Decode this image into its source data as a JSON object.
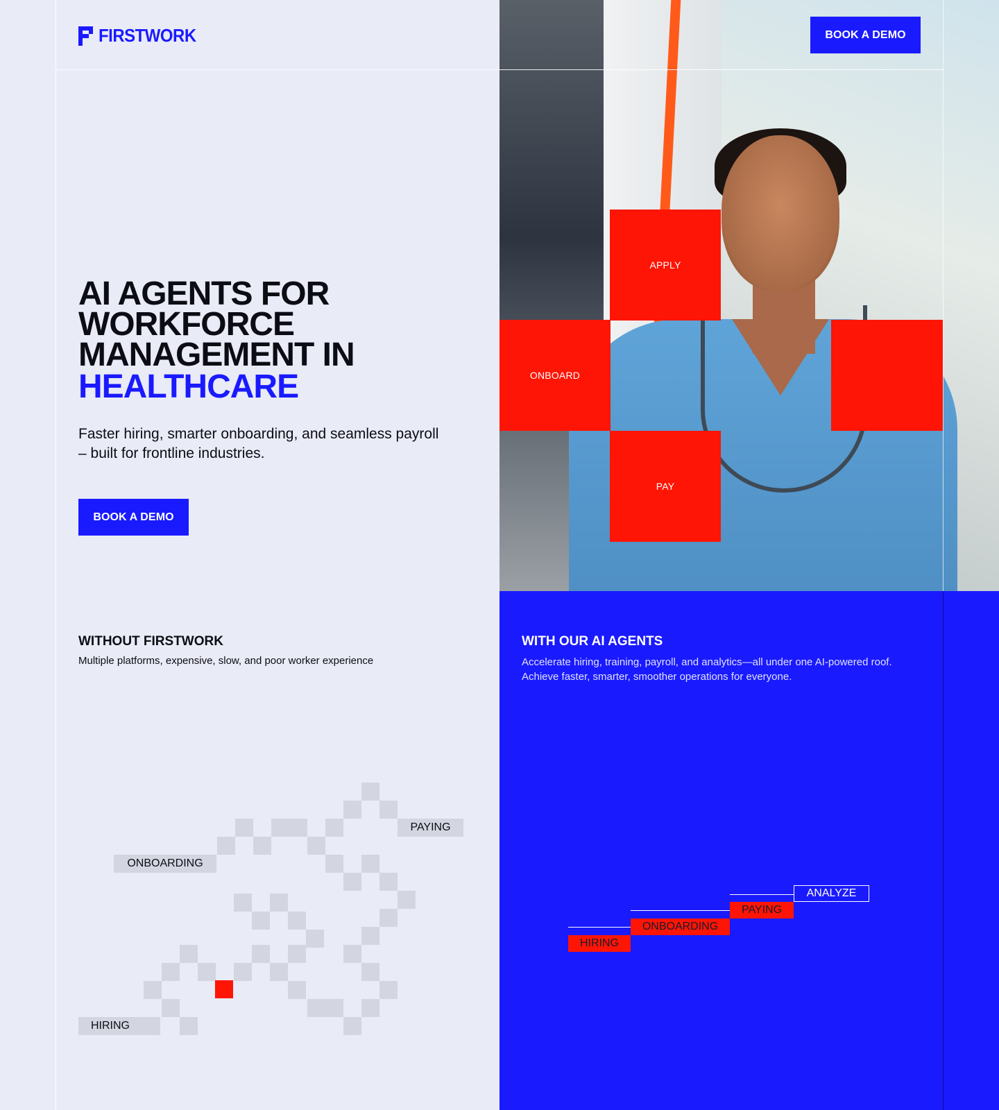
{
  "header": {
    "brand": "FIRSTWORK",
    "cta_label": "BOOK A DEMO"
  },
  "hero": {
    "headline_lines": [
      "AI AGENTS FOR",
      "WORKFORCE",
      "MANAGEMENT IN"
    ],
    "headline_accent": "HEALTHCARE",
    "subtitle": "Faster hiring, smarter onboarding, and seamless payroll – built for frontline industries.",
    "cta_label": "BOOK A DEMO",
    "tiles": [
      "APPLY",
      "ONBOARD",
      "PAY"
    ]
  },
  "without": {
    "title": "WITHOUT FIRSTWORK",
    "description": "Multiple platforms, expensive, slow, and poor worker experience",
    "labels": {
      "paying": "PAYING",
      "onboarding": "ONBOARDING",
      "hiring": "HIRING"
    }
  },
  "with": {
    "title": "WITH OUR AI AGENTS",
    "description": "Accelerate hiring, training, payroll, and analytics—all under one AI-powered roof. Achieve faster, smarter, smoother operations for everyone.",
    "steps": [
      "HIRING",
      "ONBOARDING",
      "PAYING",
      "ANALYZE"
    ]
  },
  "colors": {
    "brand_blue": "#1a1aff",
    "accent_red": "#ff1505",
    "background": "#e9ebf6"
  }
}
